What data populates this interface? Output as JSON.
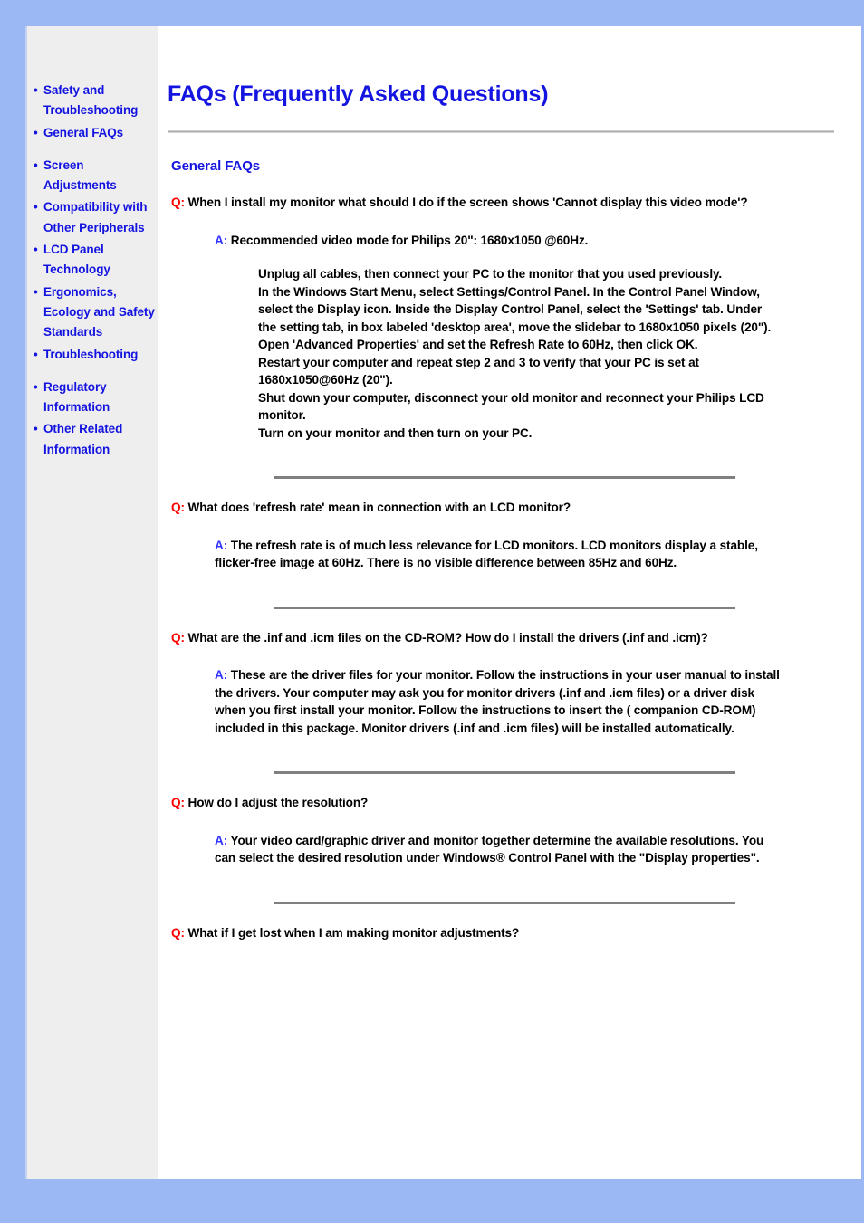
{
  "colors": {
    "page_background": "#9bb8f5",
    "sidebar_background": "#eeeeee",
    "content_background": "#ffffff",
    "link_blue": "#1414e0",
    "question_red": "#ff0000",
    "answer_blue": "#3333ff",
    "divider_gray": "#808080"
  },
  "sidebar": {
    "groups": [
      {
        "items": [
          {
            "label": "Safety and Troubleshooting"
          },
          {
            "label": "General FAQs"
          }
        ]
      },
      {
        "items": [
          {
            "label": "Screen Adjustments"
          },
          {
            "label": "Compatibility with Other Peripherals"
          },
          {
            "label": "LCD Panel Technology"
          },
          {
            "label": "Ergonomics, Ecology and Safety Standards"
          },
          {
            "label": "Troubleshooting"
          }
        ]
      },
      {
        "items": [
          {
            "label": "Regulatory Information"
          },
          {
            "label": "Other Related Information"
          }
        ]
      }
    ]
  },
  "main": {
    "title": "FAQs (Frequently Asked Questions)",
    "section_heading": "General FAQs",
    "q_prefix": "Q:",
    "a_prefix": "A:",
    "faqs": [
      {
        "question": "When I install my monitor what should I do if the screen shows 'Cannot display this video mode'?",
        "answer": "Recommended video mode for Philips 20\": 1680x1050 @60Hz.",
        "steps": [
          "Unplug all cables, then connect your PC to the monitor that you used previously.",
          "In the Windows Start Menu, select Settings/Control Panel. In the Control Panel Window, select the Display icon. Inside the Display Control Panel, select the 'Settings' tab. Under the setting tab, in box labeled 'desktop area', move the slidebar to 1680x1050 pixels (20\").",
          "Open 'Advanced Properties' and set the Refresh Rate to 60Hz, then click OK.",
          "Restart your computer and repeat step 2 and 3 to verify that your PC is set at 1680x1050@60Hz (20\").",
          "Shut down your computer, disconnect your old monitor and reconnect your Philips LCD monitor.",
          "Turn on your monitor and then turn on your PC."
        ]
      },
      {
        "question": "What does 'refresh rate' mean in connection with an LCD monitor?",
        "answer": "The refresh rate is of much less relevance for LCD monitors. LCD monitors display a stable, flicker-free image at 60Hz. There is no visible difference between 85Hz and 60Hz.",
        "steps": []
      },
      {
        "question": "What are the .inf and .icm files on the CD-ROM? How do I install the drivers (.inf and .icm)?",
        "answer": "These are the driver files for your monitor. Follow the instructions in your user manual to install the drivers. Your computer may ask you for monitor drivers (.inf and .icm files) or a driver disk when you first install your monitor. Follow the instructions to insert the ( companion CD-ROM) included in this package. Monitor drivers (.inf and .icm files) will be installed automatically.",
        "steps": []
      },
      {
        "question": "How do I adjust the resolution?",
        "answer": "Your video card/graphic driver and monitor together determine the available resolutions. You can select the desired resolution under Windows® Control Panel with the \"Display properties\".",
        "steps": []
      },
      {
        "question": "What if I get lost when I am making monitor adjustments?",
        "answer": "",
        "steps": []
      }
    ]
  }
}
